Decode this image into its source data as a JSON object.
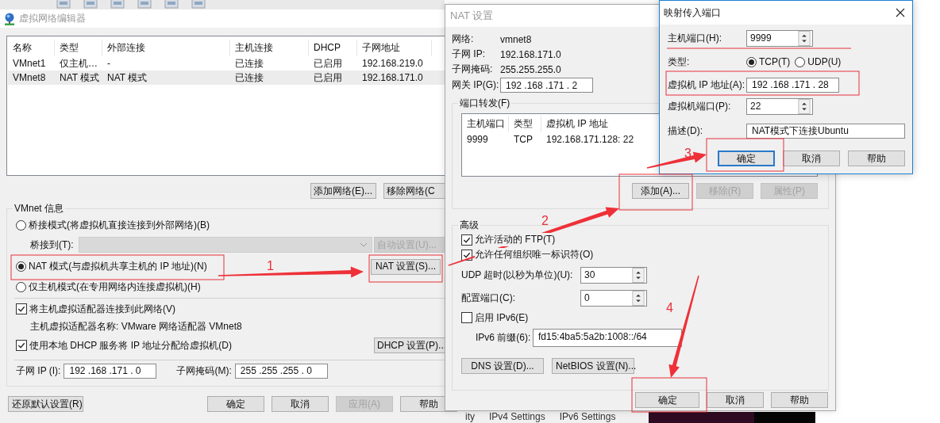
{
  "editor": {
    "title": "虚拟网络编辑器",
    "table": {
      "columns": [
        "名称",
        "类型",
        "外部连接",
        "主机连接",
        "DHCP",
        "子网地址"
      ],
      "rows": [
        {
          "cells": [
            "VMnet1",
            "仅主机…",
            "-",
            "已连接",
            "已启用",
            "192.168.219.0"
          ],
          "selected": false
        },
        {
          "cells": [
            "VMnet8",
            "NAT 模式",
            "NAT 模式",
            "已连接",
            "已启用",
            "192.168.171.0"
          ],
          "selected": true
        }
      ]
    },
    "list_buttons": [
      {
        "label": "添加网络(E)...",
        "disabled": false
      },
      {
        "label": "移除网络(C",
        "disabled": false
      }
    ],
    "group_title": "VMnet 信息",
    "modes": [
      {
        "label": "桥接模式(将虚拟机直接连接到外部网络)(B)",
        "selected": false
      },
      {
        "label": "NAT 模式(与虚拟机共享主机的 IP 地址)(N)",
        "selected": true
      },
      {
        "label": "仅主机模式(在专用网络内连接虚拟机)(H)",
        "selected": false
      }
    ],
    "bridge": {
      "label": "桥接到(T):",
      "disabled": true,
      "button": {
        "label": "自动设置(U)...",
        "disabled": true
      }
    },
    "nat_button": {
      "label": "NAT 设置(S)...",
      "disabled": false
    },
    "host_adapter": {
      "label": "将主机虚拟适配器连接到此网络(V)",
      "checked": true
    },
    "adapter_name": "主机虚拟适配器名称: VMware 网络适配器 VMnet8",
    "dhcp": {
      "label": "使用本地 DHCP 服务将 IP 地址分配给虚拟机(D)",
      "checked": true,
      "button": {
        "label": "DHCP 设置(P)...",
        "disabled": false
      }
    },
    "subnet_ip": {
      "label": "子网 IP (I):",
      "value": "192 .168 .171 . 0"
    },
    "subnet_mask": {
      "label": "子网掩码(M):",
      "value": "255 .255 .255 . 0"
    },
    "footer_buttons": [
      {
        "label": "还原默认设置(R)",
        "disabled": false
      },
      {
        "label": "确定",
        "disabled": false
      },
      {
        "label": "取消",
        "disabled": false
      },
      {
        "label": "应用(A)",
        "disabled": true
      },
      {
        "label": "帮助",
        "disabled": false
      }
    ]
  },
  "nat": {
    "title": "NAT 设置",
    "info": [
      {
        "label": "网络:",
        "value": "vmnet8"
      },
      {
        "label": "子网 IP:",
        "value": "192.168.171.0"
      },
      {
        "label": "子网掩码:",
        "value": "255.255.255.0"
      }
    ],
    "gateway": {
      "label": "网关 IP(G):",
      "value": "192 .168 .171 . 2"
    },
    "forwarding": {
      "title": "端口转发(F)",
      "columns": [
        "主机端口",
        "类型",
        "虚拟机 IP 地址"
      ],
      "rows": [
        {
          "cells": [
            "9999",
            "TCP",
            "192.168.171.128: 22"
          ],
          "selected": false
        }
      ],
      "buttons": [
        {
          "label": "添加(A)...",
          "disabled": false
        },
        {
          "label": "移除(R)",
          "disabled": true
        },
        {
          "label": "属性(P)",
          "disabled": true
        }
      ]
    },
    "advanced": {
      "title": "高级",
      "options": [
        {
          "label": "允许活动的 FTP(T)",
          "checked": true
        },
        {
          "label": "允许任何组织唯一标识符(O)",
          "checked": true
        }
      ],
      "udp_timeout": {
        "label": "UDP 超时(以秒为单位)(U):",
        "value": "30"
      },
      "config_port": {
        "label": "配置端口(C):",
        "value": "0"
      },
      "ipv6": {
        "label": "启用 IPv6(E)",
        "checked": false
      },
      "ipv6_prefix": {
        "label": "IPv6 前缀(6):",
        "value": "fd15:4ba5:5a2b:1008::/64"
      },
      "buttons": [
        "DNS 设置(D)...",
        "NetBIOS 设置(N)..."
      ]
    },
    "footer_buttons": [
      "确定",
      "取消",
      "帮助"
    ]
  },
  "mapping": {
    "title": "映射传入端口",
    "host_port": {
      "label": "主机端口(H):",
      "value": "9999"
    },
    "type": {
      "label": "类型:",
      "options": [
        {
          "label": "TCP(T)",
          "selected": true
        },
        {
          "label": "UDP(U)",
          "selected": false
        }
      ]
    },
    "vm_ip": {
      "label": "虚拟机 IP 地址(A):",
      "value": "192 .168 .171 . 28"
    },
    "vm_port": {
      "label": "虚拟机端口(P):",
      "value": "22"
    },
    "description": {
      "label": "描述(D):",
      "value": "NAT模式下连接Ubuntu"
    },
    "buttons": [
      {
        "label": "确定",
        "focused": true
      },
      {
        "label": "取消",
        "focused": false
      },
      {
        "label": "帮助",
        "focused": false
      }
    ]
  },
  "annotations": [
    {
      "number": "1"
    },
    {
      "number": "2"
    },
    {
      "number": "3"
    },
    {
      "number": "4"
    }
  ],
  "background_tabs": [
    "ity",
    "IPv4 Settings",
    "IPv6 Settings"
  ]
}
